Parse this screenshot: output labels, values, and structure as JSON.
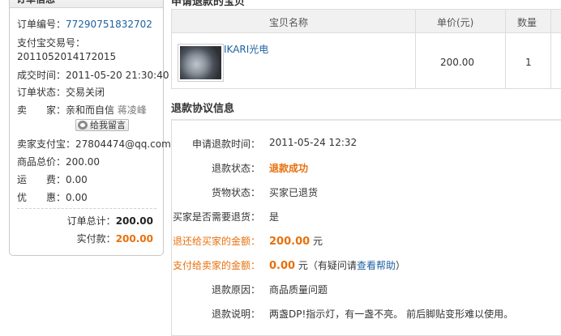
{
  "order": {
    "header": "订单信息",
    "order_no_label": "订单编号：",
    "order_no": "77290751832702",
    "alipay_label": "支付宝交易号：",
    "alipay_no": "2011052014172015",
    "deal_time_label": "成交时间：",
    "deal_time": "2011-05-20 21:30:40",
    "status_label": "订单状态：",
    "status": "交易关闭",
    "seller_label": "卖　　家：",
    "seller_name": "亲和而自信",
    "seller_alias": "蒋凌峰",
    "message_button": "给我留言",
    "seller_alipay_label": "卖家支付宝：",
    "seller_alipay": "27804474@qq.com",
    "goods_total_label": "商品总价：",
    "goods_total": "200.00",
    "shipping_label": "运　　费：",
    "shipping": "0.00",
    "discount_label": "优　　惠：",
    "discount": "0.00",
    "order_total_label": "订单总计：",
    "order_total": "200.00",
    "paid_label": "实付款：",
    "paid": "200.00"
  },
  "product_section": {
    "title": "申请退款的宝贝",
    "col_name": "宝贝名称",
    "col_price": "单价(元)",
    "col_qty": "数量",
    "item_name": "IKARI光电",
    "item_price": "200.00",
    "item_qty": "1"
  },
  "refund": {
    "title": "退款协议信息",
    "apply_time_label": "申请退款时间：",
    "apply_time": "2011-05-24 12:32",
    "status_label": "退款状态：",
    "status": "退款成功",
    "goods_status_label": "货物状态：",
    "goods_status": "买家已退货",
    "need_return_label": "买家是否需要退货：",
    "need_return": "是",
    "refund_buyer_label": "退还给买家的金额：",
    "refund_buyer_amount": "200.00",
    "refund_buyer_unit": "元",
    "pay_seller_label": "支付给卖家的金额：",
    "pay_seller_amount": "0.00",
    "pay_seller_unit": "元",
    "pay_seller_note_pre": "（有疑问请",
    "help_link": "查看帮助",
    "pay_seller_note_post": "）",
    "reason_label": "退款原因：",
    "reason": "商品质量问题",
    "desc_label": "退款说明：",
    "desc": "两盏DP!指示灯，有一盏不亮。 前后脚贴变形难以使用。"
  },
  "colors": {
    "accent_orange": "#e8700c",
    "link_blue": "#1d5f9e"
  }
}
